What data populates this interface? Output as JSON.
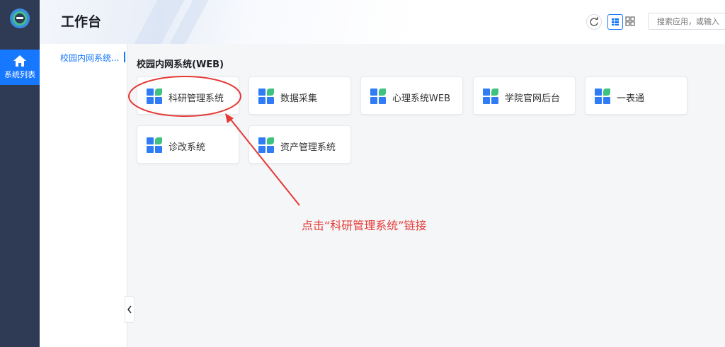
{
  "rail": {
    "logo": "campus-logo-icon",
    "active_item": {
      "icon": "home-icon",
      "label": "系统列表"
    }
  },
  "header": {
    "title": "工作台",
    "tools": [
      {
        "icon": "refresh-icon"
      },
      {
        "icon": "list-view-icon",
        "active": true
      },
      {
        "icon": "grid-view-icon"
      }
    ],
    "search": {
      "placeholder": "搜索应用，或输入"
    }
  },
  "subnav": {
    "items": [
      {
        "label": "校园内网系统...",
        "active": true
      }
    ]
  },
  "main": {
    "section_title": "校园内网系统(WEB)",
    "apps": [
      {
        "label": "科研管理系统"
      },
      {
        "label": "数据采集"
      },
      {
        "label": "心理系统WEB"
      },
      {
        "label": "学院官网后台"
      },
      {
        "label": "一表通"
      },
      {
        "label": "诊改系统"
      },
      {
        "label": "资产管理系统"
      }
    ]
  },
  "annotation": {
    "text": "点击“科研管理系统”链接",
    "color": "#e53935"
  },
  "colors": {
    "accent": "#1677ff",
    "rail": "#2f3a55",
    "app_icon_blue": "#2f7cf6",
    "app_icon_green": "#3fc27f"
  }
}
